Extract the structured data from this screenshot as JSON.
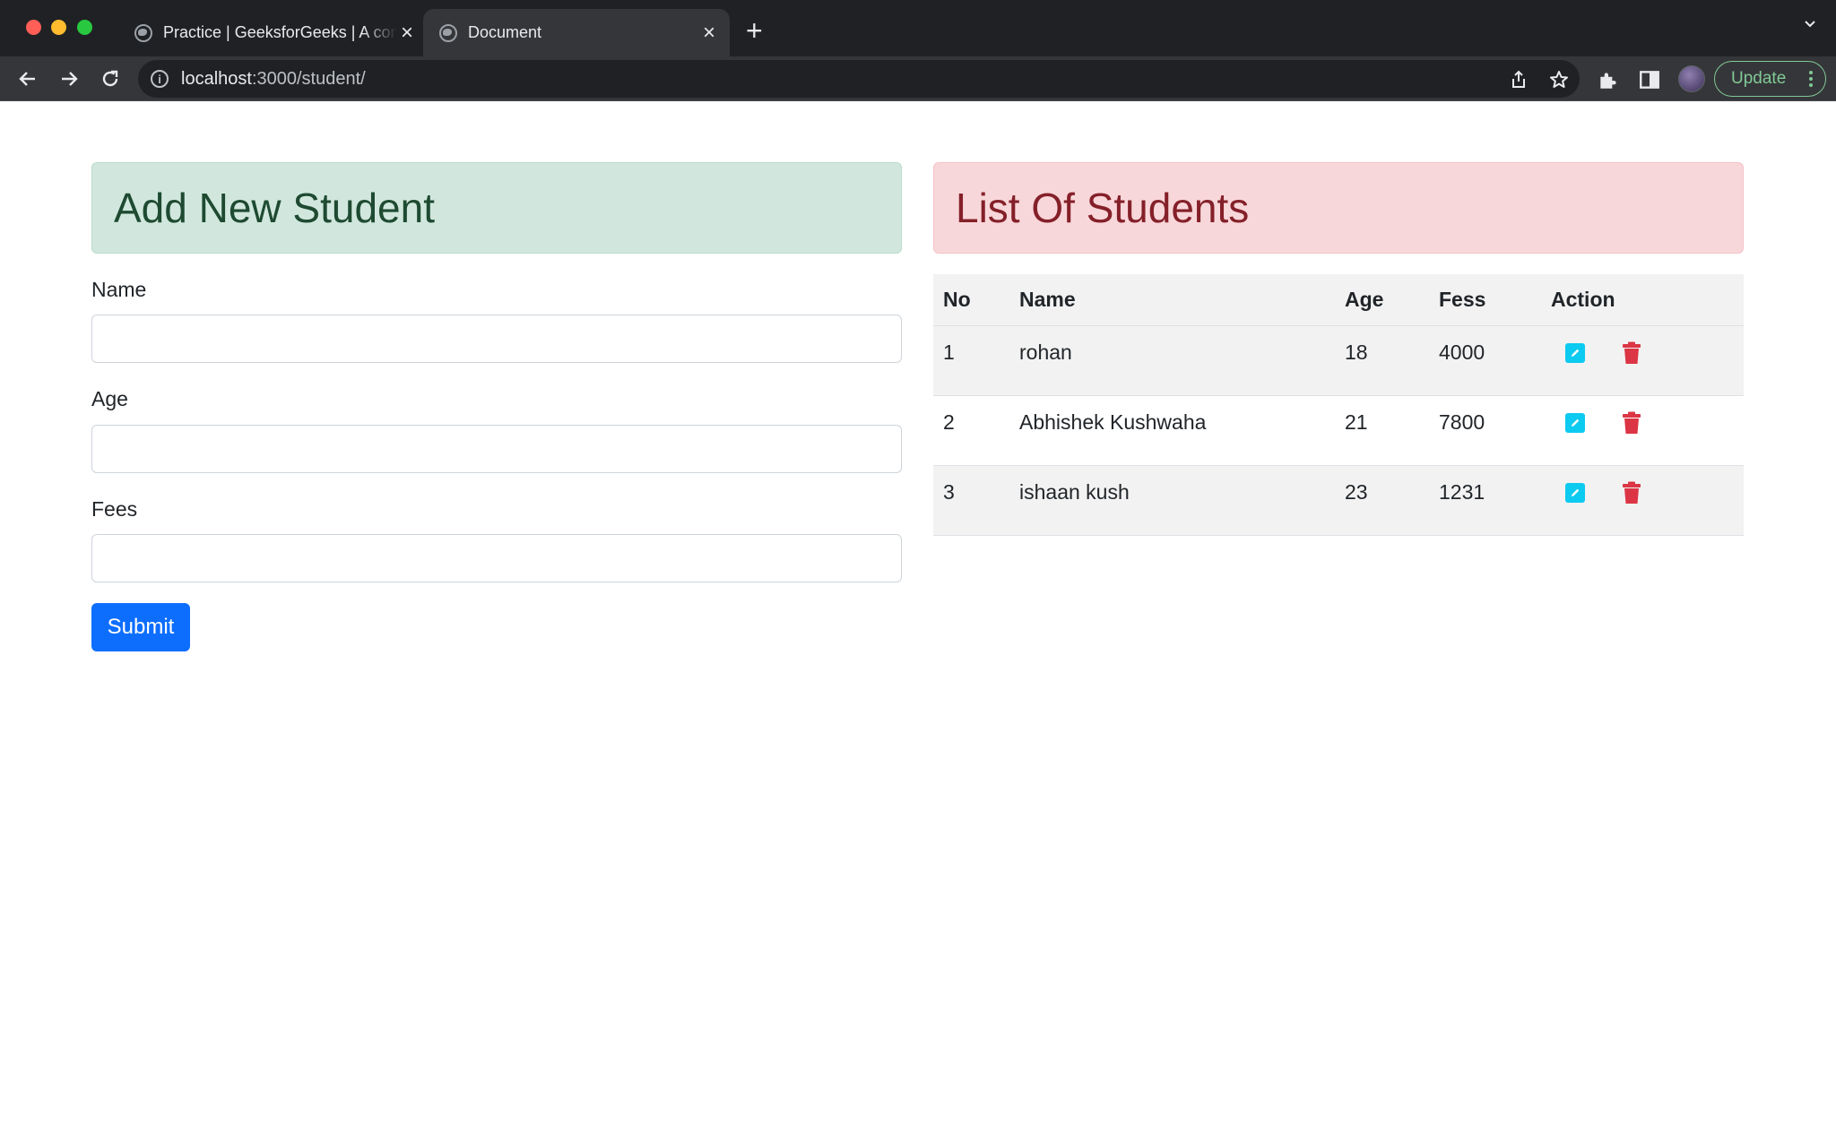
{
  "browser": {
    "tabs": [
      {
        "title": "Practice | GeeksforGeeks | A computer science portal for geeks",
        "active": false
      },
      {
        "title": "Document",
        "active": true
      }
    ],
    "url": {
      "host": "localhost",
      "path": ":3000/student/"
    },
    "update_label": "Update"
  },
  "form": {
    "heading": "Add New Student",
    "fields": [
      {
        "label": "Name",
        "value": ""
      },
      {
        "label": "Age",
        "value": ""
      },
      {
        "label": "Fees",
        "value": ""
      }
    ],
    "submit_label": "Submit"
  },
  "list": {
    "heading": "List Of Students",
    "columns": [
      "No",
      "Name",
      "Age",
      "Fess",
      "Action"
    ],
    "rows": [
      {
        "no": "1",
        "name": "rohan",
        "age": "18",
        "fees": "4000"
      },
      {
        "no": "2",
        "name": "Abhishek Kushwaha",
        "age": "21",
        "fees": "7800"
      },
      {
        "no": "3",
        "name": "ishaan kush",
        "age": "23",
        "fees": "1231"
      }
    ],
    "icons": {
      "edit": "edit-icon",
      "delete": "trash-icon"
    }
  },
  "colors": {
    "success_bg": "#d1e7dd",
    "success_text": "#1e4a31",
    "danger_bg": "#f8d7da",
    "danger_text": "#842029",
    "primary": "#0d6efd",
    "edit_icon": "#0dcaf0",
    "delete_icon": "#dc3545"
  }
}
